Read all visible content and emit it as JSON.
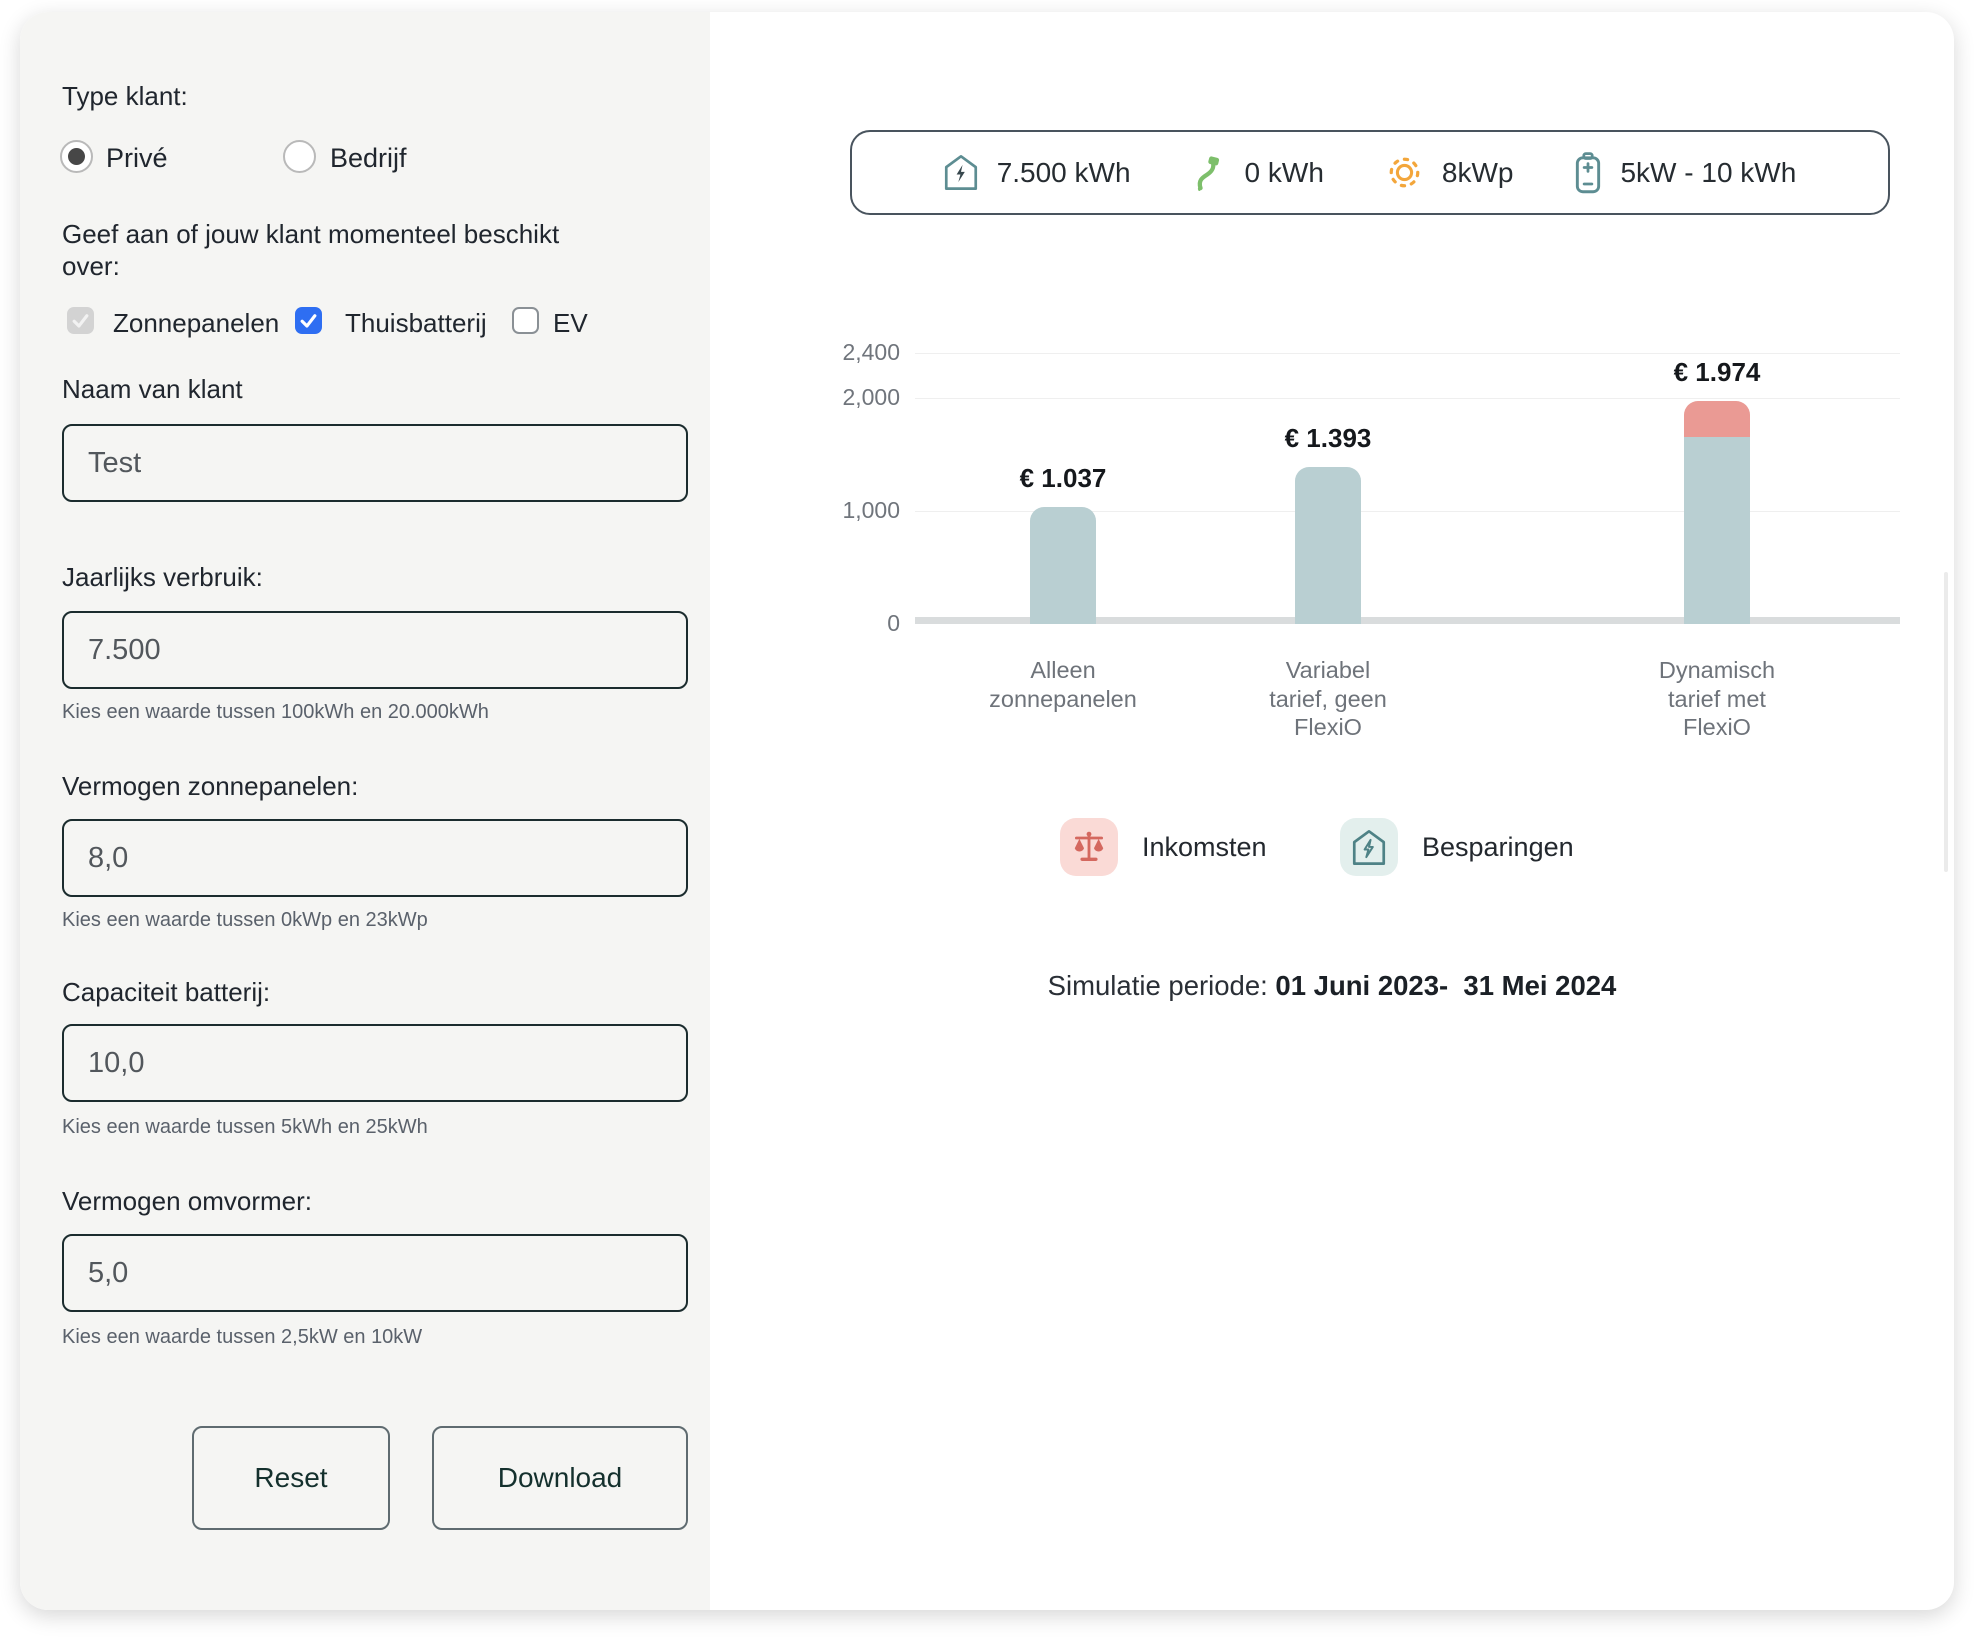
{
  "sidebar": {
    "type_klant_label": "Type klant:",
    "radio_options": [
      {
        "label": "Privé",
        "selected": true
      },
      {
        "label": "Bedrijf",
        "selected": false
      }
    ],
    "question": "Geef aan of jouw klant momenteel beschikt over:",
    "checkboxes": [
      {
        "label": "Zonnepanelen",
        "state": "checked-disabled"
      },
      {
        "label": "Thuisbatterij",
        "state": "checked"
      },
      {
        "label": "EV",
        "state": "unchecked"
      }
    ],
    "fields": [
      {
        "label": "Naam van klant",
        "value": "Test",
        "hint": ""
      },
      {
        "label": "Jaarlijks verbruik:",
        "value": "7.500",
        "hint": "Kies een waarde tussen 100kWh en 20.000kWh"
      },
      {
        "label": "Vermogen zonnepanelen:",
        "value": "8,0",
        "hint": "Kies een waarde tussen 0kWp en 23kWp"
      },
      {
        "label": "Capaciteit batterij:",
        "value": "10,0",
        "hint": "Kies een waarde tussen 5kWh en 25kWh"
      },
      {
        "label": "Vermogen omvormer:",
        "value": "5,0",
        "hint": "Kies een waarde tussen 2,5kW en 10kW"
      }
    ],
    "buttons": {
      "reset": "Reset",
      "download": "Download"
    }
  },
  "stats": {
    "items": [
      {
        "icon": "house-energy-icon",
        "value": "7.500 kWh"
      },
      {
        "icon": "ev-charger-icon",
        "value": "0 kWh"
      },
      {
        "icon": "sun-icon",
        "value": "8kWp"
      },
      {
        "icon": "battery-icon",
        "value": "5kW - 10 kWh"
      }
    ]
  },
  "chart_data": {
    "type": "bar",
    "stacked": true,
    "categories": [
      "Alleen\nzonnepanelen",
      "Variabel\ntarief, geen\nFlexiO",
      "Dynamisch\ntarief met\nFlexiO"
    ],
    "series": [
      {
        "name": "Besparingen",
        "color": "#b9cfd2",
        "values": [
          1037,
          1393,
          1660
        ]
      },
      {
        "name": "Inkomsten",
        "color": "#ea9a94",
        "values": [
          0,
          0,
          314
        ]
      }
    ],
    "totals_labels": [
      "€ 1.037",
      "€ 1.393",
      "€ 1.974"
    ],
    "totals": [
      1037,
      1393,
      1974
    ],
    "yticks": [
      0,
      1000,
      2000,
      2400
    ],
    "ytick_labels": [
      "0",
      "1,000",
      "2,000",
      "2,400"
    ],
    "ylim": [
      0,
      2400
    ],
    "grid": true,
    "legend_position": "bottom",
    "legend": [
      {
        "label": "Inkomsten",
        "icon": "scale-icon",
        "accent": "#d4685f",
        "bg": "#fadad6"
      },
      {
        "label": "Besparingen",
        "icon": "house-energy-icon",
        "accent": "#4e8286",
        "bg": "#e3efed"
      }
    ]
  },
  "footer": {
    "sim_label": "Simulatie periode: ",
    "sim_value": "01 Juni 2023-  31 Mei 2024"
  }
}
